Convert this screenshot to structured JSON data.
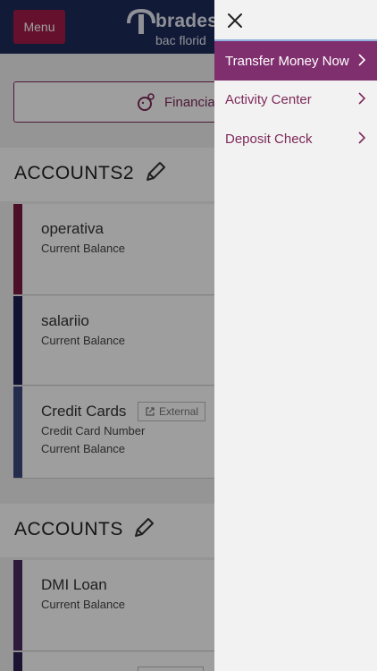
{
  "header": {
    "menu_label": "Menu",
    "logo_line1": "brades",
    "logo_line2": "bac florid"
  },
  "financial_button": {
    "label": "Financial"
  },
  "sections": [
    {
      "title": "ACCOUNTS2",
      "accounts": [
        {
          "name": "operativa",
          "line1": "Current Balance",
          "color": "#7a1a3f"
        },
        {
          "name": "salariio",
          "line1": "Current Balance",
          "color": "#1a2052"
        },
        {
          "name": "Credit Cards",
          "line1": "Credit Card Number",
          "line2": "Current Balance",
          "badge": "External",
          "color": "#3a4a7f"
        }
      ]
    },
    {
      "title": "ACCOUNTS",
      "accounts": [
        {
          "name": "DMI Loan",
          "line1": "Current Balance",
          "color": "#4b2a5e"
        }
      ]
    }
  ],
  "drawer": {
    "items": [
      {
        "label": "Transfer Money Now",
        "active": true
      },
      {
        "label": "Activity Center",
        "active": false
      },
      {
        "label": "Deposit Check",
        "active": false
      }
    ]
  },
  "colors": {
    "navy": "#1c2a5a",
    "maroon": "#a31c4a",
    "purple": "#7f2f6e",
    "drawer_text": "#7d2a5a"
  },
  "icons": [
    "close-icon",
    "chevron-right-icon",
    "pencil-icon",
    "external-link-icon",
    "piggy-bank-icon",
    "bradesco-logo"
  ]
}
